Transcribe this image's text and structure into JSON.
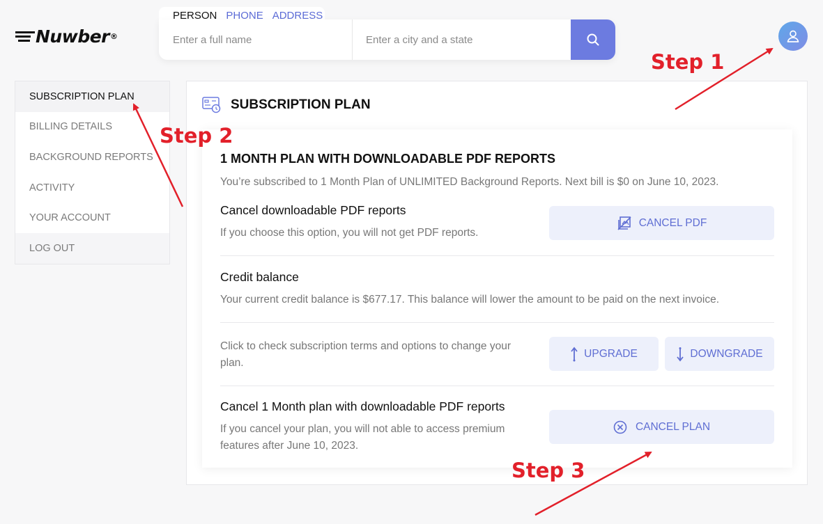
{
  "logo": {
    "text": "Nuwber",
    "mark": "®"
  },
  "search": {
    "tabs": [
      "PERSON",
      "PHONE",
      "ADDRESS"
    ],
    "name_placeholder": "Enter a full name",
    "city_placeholder": "Enter a city and a state"
  },
  "sidebar": {
    "items": [
      {
        "label": "SUBSCRIPTION PLAN"
      },
      {
        "label": "BILLING DETAILS"
      },
      {
        "label": "BACKGROUND REPORTS"
      },
      {
        "label": "ACTIVITY"
      },
      {
        "label": "YOUR ACCOUNT"
      },
      {
        "label": "LOG OUT"
      }
    ]
  },
  "main": {
    "title": "SUBSCRIPTION PLAN",
    "plan_title": "1 MONTH PLAN WITH DOWNLOADABLE PDF REPORTS",
    "plan_sub": "You’re subscribed to 1 Month Plan of UNLIMITED Background Reports. Next bill is $0 on June 10, 2023.",
    "pdf": {
      "title": "Cancel downloadable PDF reports",
      "text": "If you choose this option, you will not get PDF reports.",
      "button": "CANCEL PDF"
    },
    "credit": {
      "title": "Credit balance",
      "text": "Your current credit balance is $677.17. This balance will lower the amount to be paid on the next invoice."
    },
    "terms": {
      "text_line1": "Click to check subscription terms and options to change your",
      "text_line2": "plan.",
      "upgrade": "UPGRADE",
      "downgrade": "DOWNGRADE"
    },
    "cancel_plan": {
      "title": "Cancel 1 Month plan with downloadable PDF reports",
      "text_line1": "If you cancel your plan, you will not able to access premium",
      "text_line2": "features after June 10, 2023.",
      "button": "CANCEL PLAN"
    }
  },
  "annotations": {
    "step1": "Step 1",
    "step2": "Step 2",
    "step3": "Step 3",
    "color": "#e2202a"
  },
  "colors": {
    "accent": "#6c7be0",
    "button_bg": "#edf0fb",
    "button_text": "#5f6ed3"
  }
}
